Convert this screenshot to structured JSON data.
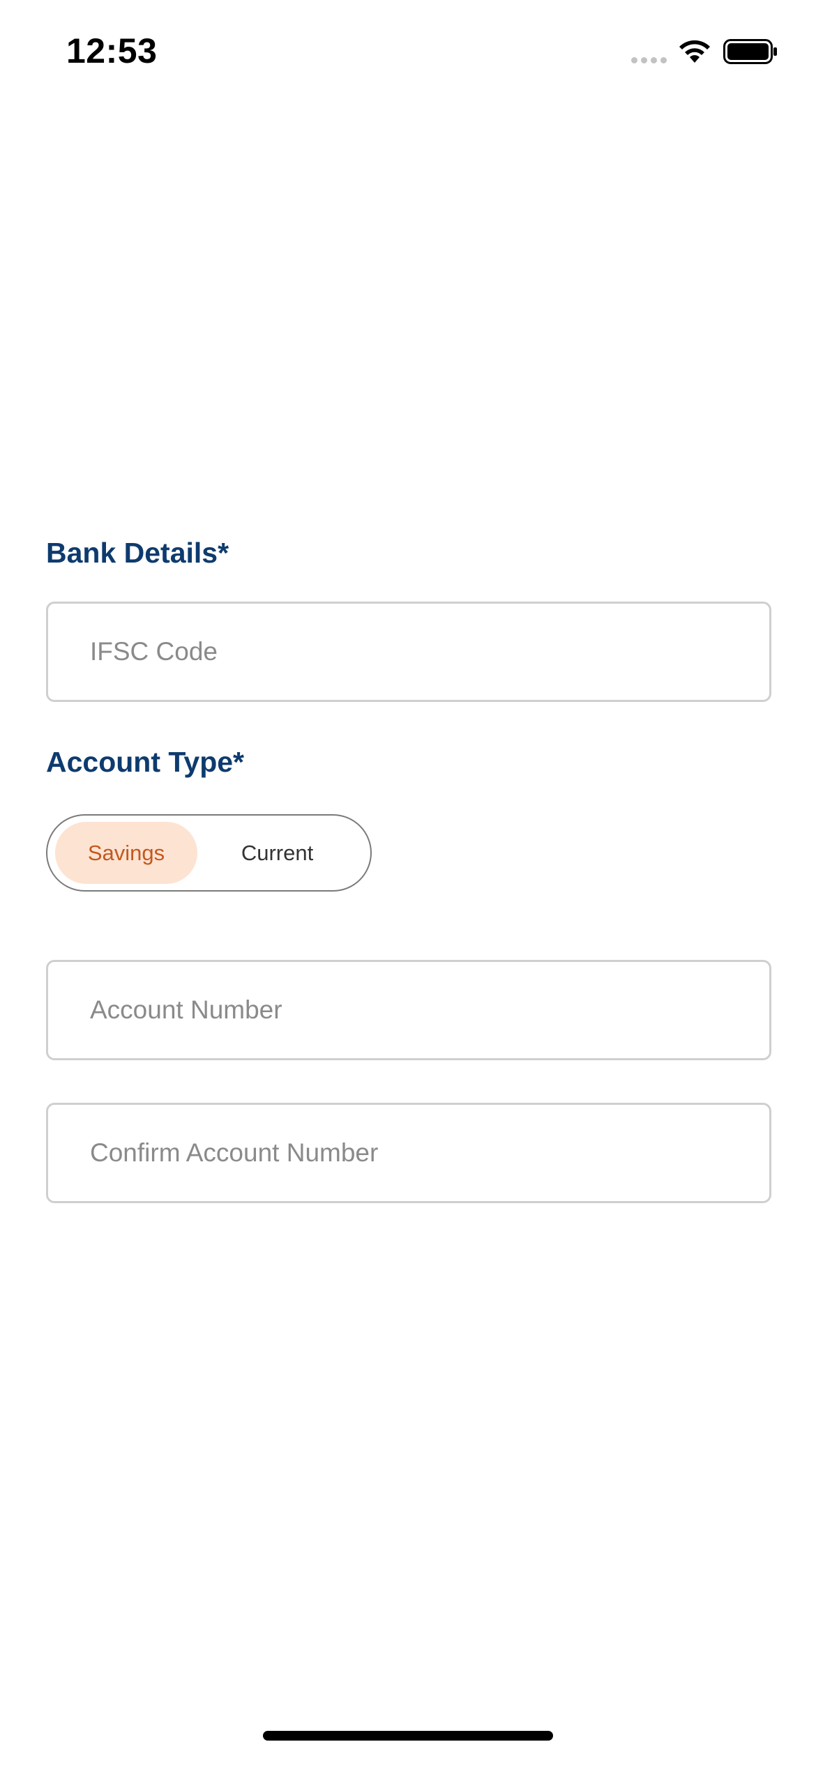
{
  "status_bar": {
    "time": "12:53"
  },
  "bank_details": {
    "title": "Bank Details*",
    "ifsc_placeholder": "IFSC Code",
    "ifsc_value": ""
  },
  "account_type": {
    "title": "Account Type*",
    "options": [
      "Savings",
      "Current"
    ],
    "selected": "Savings"
  },
  "account_number": {
    "placeholder": "Account Number",
    "value": ""
  },
  "confirm_account_number": {
    "placeholder": "Confirm Account Number",
    "value": ""
  },
  "colors": {
    "title": "#0e3b6e",
    "selected_bg": "#fde3d2",
    "selected_text": "#c4581e",
    "field_border": "#cfcfcf",
    "placeholder": "#8a8a8a"
  },
  "icons": [
    "signal-icon",
    "wifi-icon",
    "battery-icon"
  ]
}
